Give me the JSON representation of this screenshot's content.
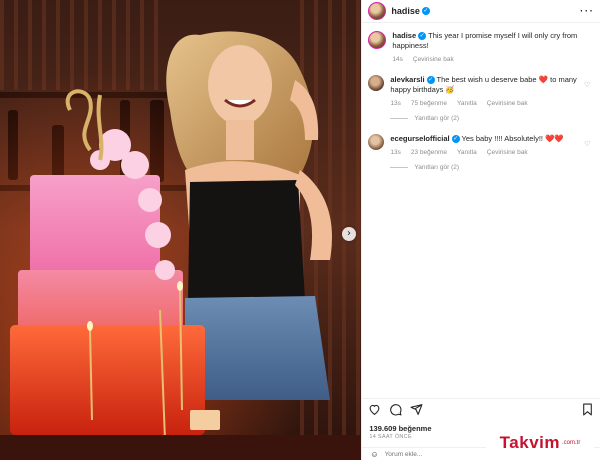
{
  "post": {
    "username": "hadise",
    "caption": "This year I promise myself I will only cry from happiness!",
    "caption_age": "14s",
    "caption_translate": "Çevirisine bak",
    "likes": "139.609 beğenme",
    "timestamp": "14 SAAT ÖNCE",
    "add_comment_placeholder": "Yorum ekle..."
  },
  "comments": [
    {
      "username": "alevkarsli",
      "text": "The best wish u deserve babe ❤️ to many happy birthdays 🥳",
      "age": "13s",
      "likes": "75 beğenme",
      "reply": "Yanıtla",
      "translate": "Çevirisine bak",
      "replies": "Yanıtları gör (2)"
    },
    {
      "username": "ecegurselofficial",
      "text": "Yes baby !!!! Absolutely!! ❤️❤️",
      "age": "13s",
      "likes": "23 beğenme",
      "reply": "Yanıtla",
      "translate": "Çevirisine bak",
      "replies": "Yanıtları gör (2)"
    }
  ],
  "icons": {
    "more": "more-options-icon",
    "like": "heart-icon",
    "comment": "comment-icon",
    "share": "share-icon",
    "save": "bookmark-icon",
    "next": "chevron-right-icon",
    "emoji": "emoji-icon"
  },
  "watermark": {
    "brand": "Takvim",
    "tld": ".com.tr"
  },
  "colors": {
    "verified": "#0095f6",
    "watermark": "#c4122f",
    "heart": "#c4122f"
  }
}
